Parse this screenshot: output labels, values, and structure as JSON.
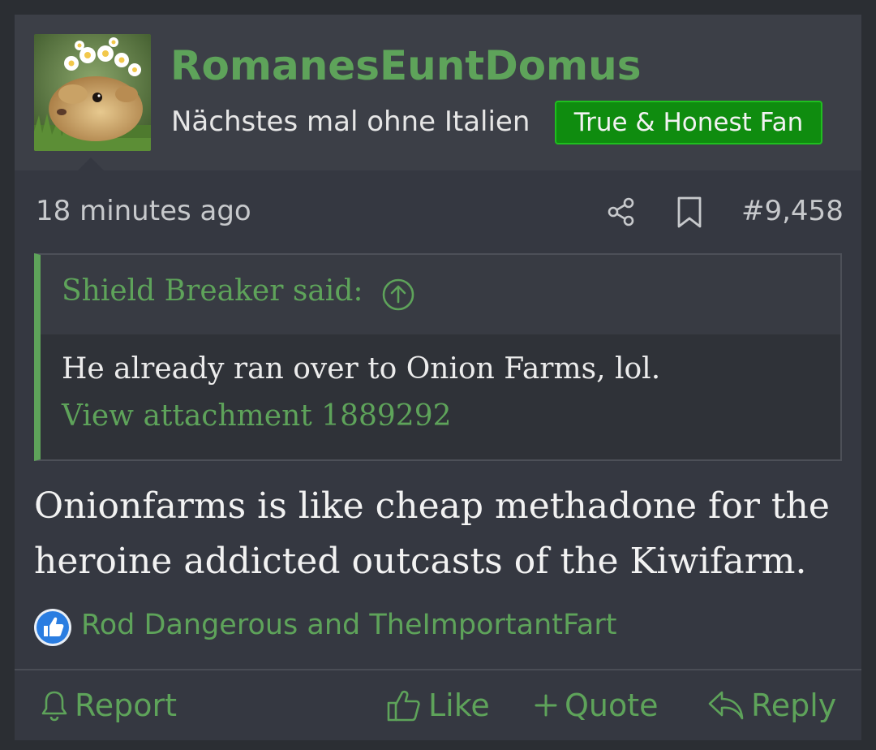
{
  "post": {
    "username": "RomanesEuntDomus",
    "user_title": "Nächstes mal ohne Italien",
    "user_badge": "True & Honest Fan",
    "timestamp": "18 minutes ago",
    "post_number": "#9,458",
    "quote": {
      "author_line": "Shield Breaker said:",
      "text": "He already ran over to Onion Farms, lol.",
      "attachment_link": "View attachment 1889292"
    },
    "message": "Onionfarms is like cheap methadone for the heroine addicted outcasts of the Kiwifarm.",
    "reactions": {
      "icon": "thumbs-up-icon",
      "users": "Rod Dangerous and TheImportantFart"
    },
    "actions": {
      "report": "Report",
      "like": "Like",
      "quote": "Quote",
      "reply": "Reply"
    }
  },
  "colors": {
    "accent": "#5ea35a",
    "badge_bg": "#0f8c0f",
    "post_bg": "#353841",
    "header_bg": "#3c3f47"
  }
}
